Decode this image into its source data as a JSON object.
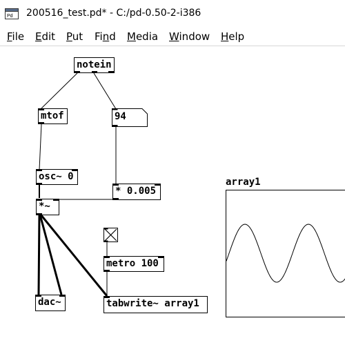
{
  "window": {
    "title": "200516_test.pd* - C:/pd-0.50-2-i386",
    "icon_text": "Pd"
  },
  "menu": [
    {
      "pre": "",
      "ul": "F",
      "post": "ile"
    },
    {
      "pre": "",
      "ul": "E",
      "post": "dit"
    },
    {
      "pre": "",
      "ul": "P",
      "post": "ut"
    },
    {
      "pre": "Fi",
      "ul": "n",
      "post": "d"
    },
    {
      "pre": "",
      "ul": "M",
      "post": "edia"
    },
    {
      "pre": "",
      "ul": "W",
      "post": "indow"
    },
    {
      "pre": "",
      "ul": "H",
      "post": "elp"
    }
  ],
  "objects": {
    "notein": "notein",
    "mtof": "mtof",
    "osc": "osc~ 0",
    "mul_sig": "*~",
    "mul_const": "* 0.005",
    "metro": "metro 100",
    "dac": "dac~",
    "tabwrite": "tabwrite~ array1"
  },
  "number_box": {
    "value": "94"
  },
  "array": {
    "name": "array1"
  },
  "colors": {
    "background": "#ffffff",
    "stroke": "#000000",
    "menu_border": "#d6d6d6"
  },
  "icons": {
    "app": "pd-app-icon",
    "bang": "bang-toggle-icon"
  }
}
